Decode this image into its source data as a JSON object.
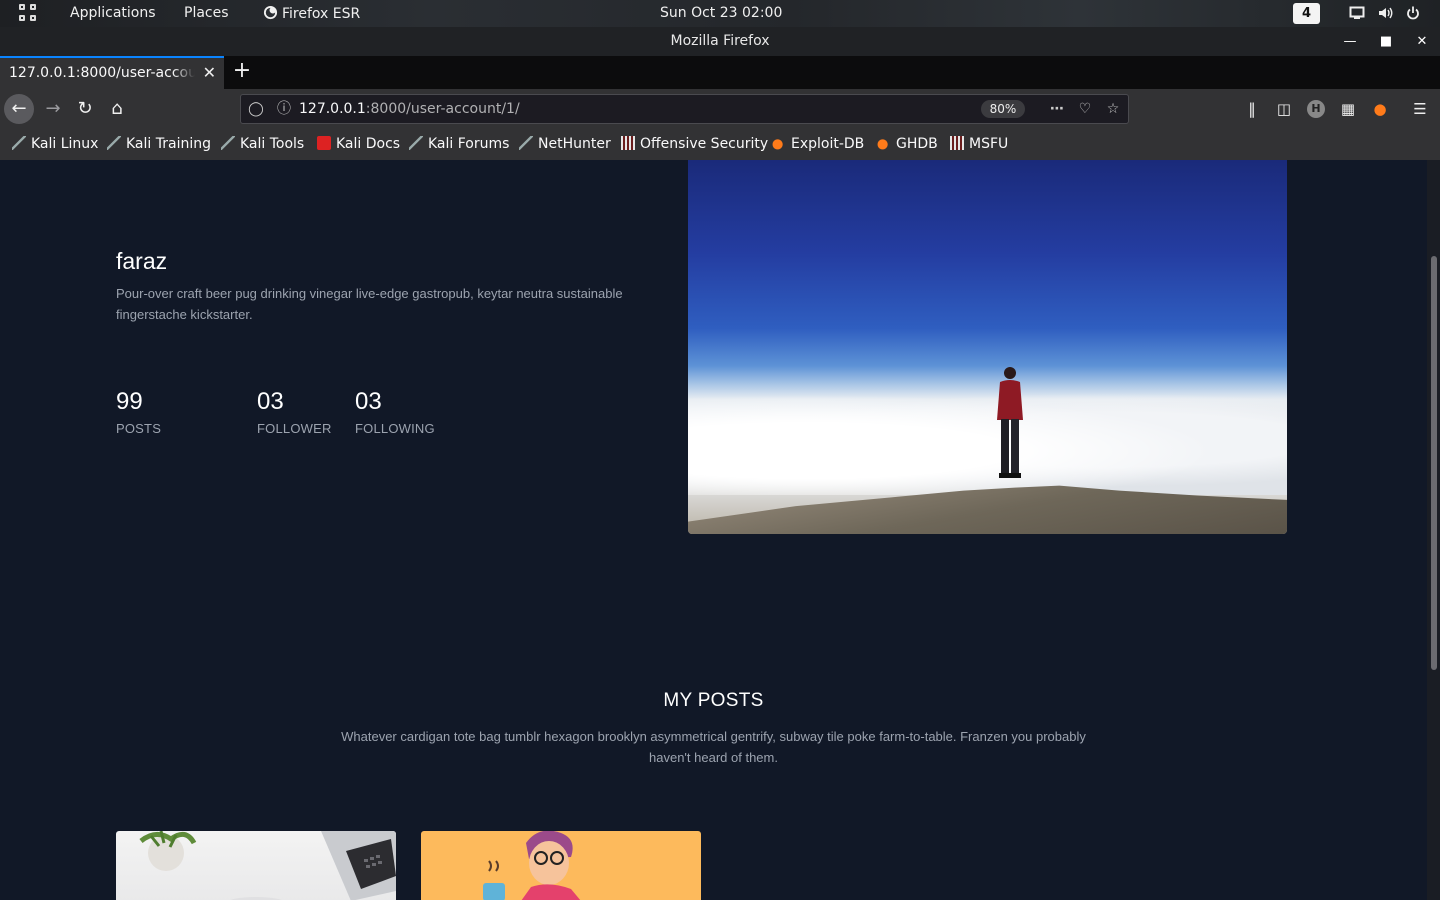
{
  "topbar": {
    "applications": "Applications",
    "places": "Places",
    "app_name": "Firefox ESR",
    "clock": "Sun Oct 23  02:00",
    "workspace": "4"
  },
  "window": {
    "title": "Mozilla Firefox"
  },
  "tab": {
    "title": "127.0.0.1:8000/user-account/1/"
  },
  "urlbar": {
    "host": "127.0.0.1",
    "path": ":8000/user-account/1/",
    "zoom": "80%"
  },
  "bookmarks": [
    {
      "label": "Kali Linux",
      "icon": "kali-dragon-icon"
    },
    {
      "label": "Kali Training",
      "icon": "kali-dragon-icon"
    },
    {
      "label": "Kali Tools",
      "icon": "kali-dragon-icon"
    },
    {
      "label": "Kali Docs",
      "icon": "kali-docs-icon"
    },
    {
      "label": "Kali Forums",
      "icon": "kali-dragon-icon"
    },
    {
      "label": "NetHunter",
      "icon": "kali-dragon-icon"
    },
    {
      "label": "Offensive Security",
      "icon": "offsec-icon"
    },
    {
      "label": "Exploit-DB",
      "icon": "exploit-db-icon"
    },
    {
      "label": "GHDB",
      "icon": "exploit-db-icon"
    },
    {
      "label": "MSFU",
      "icon": "offsec-icon"
    }
  ],
  "profile": {
    "name": "faraz",
    "bio": "Pour-over craft beer pug drinking vinegar live-edge gastropub, keytar neutra sustainable fingerstache kickstarter.",
    "stats": [
      {
        "value": "99",
        "label": "POSTS"
      },
      {
        "value": "03",
        "label": "FOLLOWER"
      },
      {
        "value": "03",
        "label": "FOLLOWING"
      }
    ]
  },
  "posts_section": {
    "title": "MY POSTS",
    "description": "Whatever cardigan tote bag tumblr hexagon brooklyn asymmetrical gentrify, subway tile poke farm-to-table. Franzen you probably haven't heard of them."
  },
  "colors": {
    "page_bg": "#111827",
    "muted_text": "#9ca3af",
    "tab_accent": "#0a84ff",
    "card2_bg": "#fdba5c"
  }
}
